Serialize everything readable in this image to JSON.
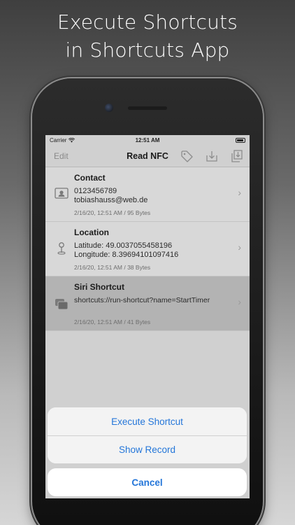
{
  "headline": {
    "line1": "Execute Shortcuts",
    "line2": "in Shortcuts App"
  },
  "status_bar": {
    "carrier": "Carrier",
    "time": "12:51 AM"
  },
  "nav": {
    "edit_label": "Edit",
    "title": "Read NFC",
    "icons": [
      "tag-icon",
      "download-icon",
      "export-icon"
    ]
  },
  "records": [
    {
      "title": "Contact",
      "line1": "0123456789",
      "line2": "tobiashauss@web.de",
      "meta": "2/16/20, 12:51 AM / 95 Bytes",
      "icon": "contact-card-icon"
    },
    {
      "title": "Location",
      "line1": "Latitude: 49.0037055458196",
      "line2": "Longitude: 8.39694101097416",
      "meta": "2/16/20, 12:51 AM / 38 Bytes",
      "icon": "location-pin-icon"
    },
    {
      "title": "Siri Shortcut",
      "line1": "shortcuts://run-shortcut?name=StartTimer",
      "meta": "2/16/20, 12:51 AM / 41 Bytes",
      "icon": "shortcut-stack-icon"
    }
  ],
  "action_sheet": {
    "execute_label": "Execute Shortcut",
    "show_label": "Show Record",
    "cancel_label": "Cancel"
  },
  "colors": {
    "accent": "#2476d9",
    "selected_row": "#b3b3b3"
  }
}
